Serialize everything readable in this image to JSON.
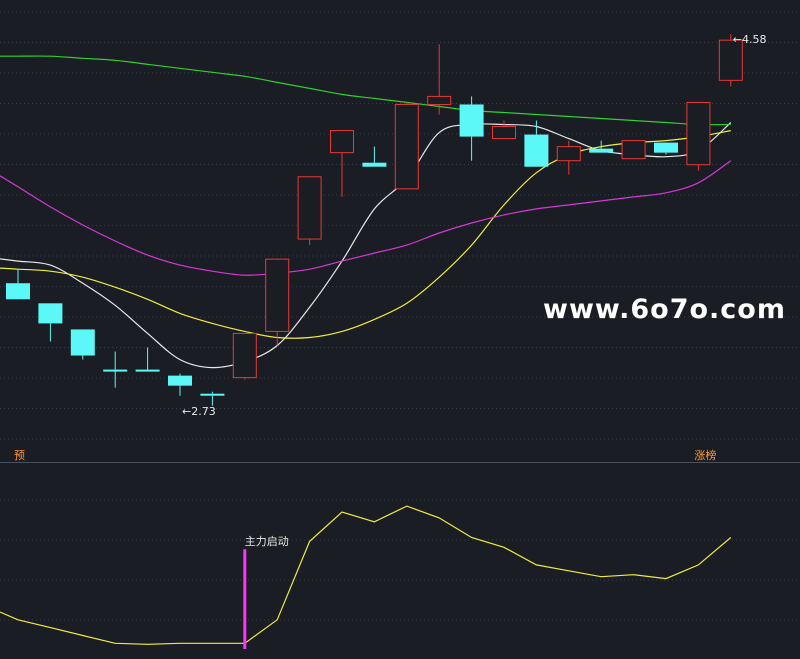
{
  "chart_data": [
    {
      "type": "candlestick",
      "ylim": [
        2.45,
        4.75
      ],
      "grid": true,
      "legend": "none",
      "colors": {
        "up": "#e53935",
        "down": "#5cf7f7",
        "ma_short": "#e8e8e8",
        "ma_mid": "#f2ec3a",
        "ma_long": "#d33ad3",
        "ma_longest": "#2fd02f"
      },
      "candles": [
        {
          "o": 3.34,
          "c": 3.26,
          "h": 3.41,
          "l": 3.26
        },
        {
          "o": 3.24,
          "c": 3.14,
          "h": 3.24,
          "l": 3.05
        },
        {
          "o": 3.11,
          "c": 2.98,
          "h": 3.11,
          "l": 2.96
        },
        {
          "o": 2.91,
          "c": 2.91,
          "h": 3.0,
          "l": 2.82
        },
        {
          "o": 2.91,
          "c": 2.9,
          "h": 3.02,
          "l": 2.9
        },
        {
          "o": 2.88,
          "c": 2.83,
          "h": 2.89,
          "l": 2.78
        },
        {
          "o": 2.79,
          "c": 2.78,
          "h": 2.8,
          "l": 2.73
        },
        {
          "o": 2.87,
          "c": 3.09,
          "h": 3.09,
          "l": 2.86
        },
        {
          "o": 3.1,
          "c": 3.46,
          "h": 3.46,
          "l": 3.03
        },
        {
          "o": 3.56,
          "c": 3.87,
          "h": 3.87,
          "l": 3.53
        },
        {
          "o": 3.99,
          "c": 4.1,
          "h": 4.1,
          "l": 3.77
        },
        {
          "o": 3.94,
          "c": 3.92,
          "h": 4.02,
          "l": 3.92
        },
        {
          "o": 3.81,
          "c": 4.23,
          "h": 4.24,
          "l": 3.81
        },
        {
          "o": 4.23,
          "c": 4.27,
          "h": 4.53,
          "l": 4.18
        },
        {
          "o": 4.23,
          "c": 4.07,
          "h": 4.27,
          "l": 3.95
        },
        {
          "o": 4.06,
          "c": 4.12,
          "h": 4.15,
          "l": 4.06
        },
        {
          "o": 4.08,
          "c": 3.92,
          "h": 4.15,
          "l": 3.92
        },
        {
          "o": 3.95,
          "c": 4.02,
          "h": 4.05,
          "l": 3.88
        },
        {
          "o": 4.01,
          "c": 3.99,
          "h": 4.05,
          "l": 3.99
        },
        {
          "o": 3.96,
          "c": 4.05,
          "h": 4.05,
          "l": 3.96
        },
        {
          "o": 4.04,
          "c": 3.99,
          "h": 4.04,
          "l": 3.98
        },
        {
          "o": 3.93,
          "c": 4.24,
          "h": 4.24,
          "l": 3.9
        },
        {
          "o": 4.35,
          "c": 4.55,
          "h": 4.58,
          "l": 4.32
        }
      ],
      "ma_lines": [
        {
          "key": "ma_short",
          "start": 0,
          "values": [
            3.45,
            3.43,
            3.34,
            3.23,
            3.09,
            2.96,
            2.92,
            2.95,
            3.03,
            3.22,
            3.45,
            3.71,
            3.86,
            4.09,
            4.13,
            4.13,
            4.12,
            4.06,
            4.0,
            3.98,
            3.97,
            4.0,
            4.14
          ]
        },
        {
          "key": "ma_mid",
          "start": 0,
          "values": [
            3.41,
            3.4,
            3.37,
            3.32,
            3.26,
            3.19,
            3.14,
            3.1,
            3.07,
            3.07,
            3.1,
            3.16,
            3.24,
            3.37,
            3.53,
            3.73,
            3.89,
            3.98,
            4.02,
            4.04,
            4.05,
            4.07,
            4.1
          ]
        },
        {
          "key": "ma_long",
          "start": 0,
          "values": [
            3.82,
            3.72,
            3.63,
            3.55,
            3.48,
            3.43,
            3.4,
            3.38,
            3.39,
            3.41,
            3.45,
            3.49,
            3.53,
            3.59,
            3.64,
            3.68,
            3.71,
            3.73,
            3.75,
            3.77,
            3.79,
            3.84,
            3.95
          ]
        },
        {
          "key": "ma_longest",
          "start": 0,
          "values": [
            4.47,
            4.47,
            4.46,
            4.45,
            4.43,
            4.41,
            4.39,
            4.37,
            4.34,
            4.31,
            4.28,
            4.26,
            4.24,
            4.22,
            4.2,
            4.19,
            4.18,
            4.17,
            4.16,
            4.15,
            4.14,
            4.13,
            4.13
          ]
        }
      ],
      "annotations": [
        {
          "text": "2.73",
          "candle": 5,
          "price": 2.73,
          "arrow": "←"
        },
        {
          "text": "4.58",
          "candle": 22,
          "price": 4.58,
          "arrow": "←"
        }
      ],
      "tags": [
        {
          "text": "预",
          "candle": 0
        },
        {
          "text": "涨榜",
          "candle": 21
        }
      ]
    },
    {
      "type": "line",
      "ylim": [
        0,
        100
      ],
      "color": "#f2ec3a",
      "values": [
        20,
        16,
        12,
        8,
        7.5,
        8,
        8,
        8,
        20,
        60,
        75,
        70,
        78,
        72,
        62,
        57,
        48,
        45,
        42,
        43,
        41,
        48,
        62
      ],
      "marker": {
        "candle": 7,
        "label": "主力启动",
        "color": "#ff33ff",
        "top": 56
      }
    }
  ],
  "watermark": "www.6o7o.com"
}
